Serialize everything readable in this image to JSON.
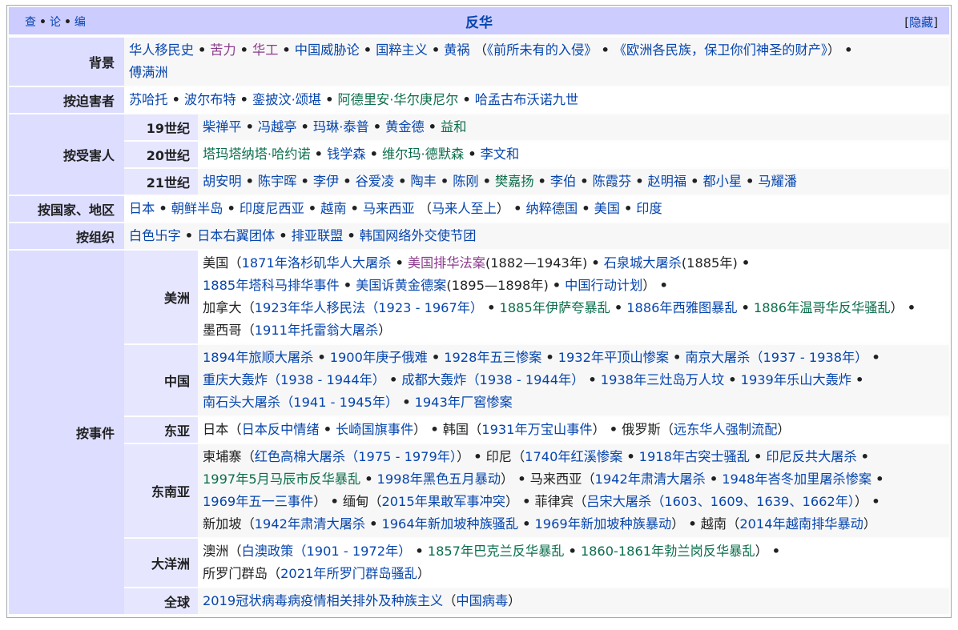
{
  "navbox": {
    "title": "反华",
    "vte": [
      "查",
      "论",
      "编"
    ],
    "hide_label": "隐藏",
    "hide_brackets": [
      "[",
      "]"
    ]
  },
  "rows": {
    "background": {
      "label": "背景",
      "items": [
        "华人移民史",
        "苦力",
        "华工",
        "中国威胁论",
        "国粹主义",
        "黄祸"
      ],
      "paren_items": [
        "《前所未有的入侵》",
        "《欧洲各民族，保卫你们神圣的财产》"
      ],
      "tail": [
        "傅满洲"
      ]
    },
    "persecutors": {
      "label": "按迫害者",
      "items": [
        "苏哈托",
        "波尔布特",
        "銮披汶·颂堪",
        "阿德里安·华尔庚尼尔",
        "哈孟古布沃诺九世"
      ]
    },
    "victims": {
      "label": "按受害人",
      "c19_label": "19世纪",
      "c19": [
        "柴禅平",
        "冯越亭",
        "玛琳·泰普",
        "黄金德",
        "益和"
      ],
      "c20_label": "20世纪",
      "c20": [
        "塔玛塔纳塔·哈约诺",
        "钱学森",
        "维尔玛·德默森",
        "李文和"
      ],
      "c21_label": "21世纪",
      "c21": [
        "胡安明",
        "陈宇晖",
        "李伊",
        "谷爱凌",
        "陶丰",
        "陈刚",
        "樊嘉扬",
        "李伯",
        "陈霞芬",
        "赵明福",
        "都小星",
        "马耀潘"
      ]
    },
    "countries": {
      "label": "按国家、地区",
      "items_a": [
        "日本",
        "朝鲜半岛",
        "印度尼西亚",
        "越南",
        "马来西亚"
      ],
      "paren": "马来人至上",
      "items_b": [
        "纳粹德国",
        "美国",
        "印度"
      ]
    },
    "orgs": {
      "label": "按组织",
      "items": [
        "白色卐字",
        "日本右翼团体",
        "排亚联盟",
        "韩国网络外交使节团"
      ]
    },
    "events": {
      "label": "按事件",
      "americas": {
        "label": "美洲",
        "us": "美国",
        "us_items": [
          "1871年洛杉矶华人大屠杀",
          "美国排华法案",
          "(1882—1943年)",
          "石泉城大屠杀",
          "(1885年)",
          "1885年塔科马排华事件",
          "美国诉黄金德案",
          "(1895—1898年)",
          "中国行动计划"
        ],
        "canada": "加拿大",
        "canada_items": [
          "1923年华人移民法（1923 - 1967年）",
          "1885年伊萨夸暴乱",
          "1886年西雅图暴乱",
          "1886年温哥华反华骚乱"
        ],
        "mexico": "墨西哥",
        "mexico_items": [
          "1911年托雷翁大屠杀"
        ]
      },
      "china": {
        "label": "中国",
        "items": [
          "1894年旅顺大屠杀",
          "1900年庚子俄难",
          "1928年五三惨案",
          "1932年平顶山惨案",
          "南京大屠杀（1937 - 1938年）",
          "重庆大轰炸（1938 - 1944年）",
          "成都大轰炸（1938 - 1944年）",
          "1938年三灶岛万人坟",
          "1939年乐山大轰炸",
          "南石头大屠杀（1941 - 1945年）",
          "1943年厂窖惨案"
        ]
      },
      "east_asia": {
        "label": "东亚",
        "japan": "日本",
        "japan_items": [
          "日本反中情绪",
          "长崎国旗事件"
        ],
        "korea": "韩国",
        "korea_items": [
          "1931年万宝山事件"
        ],
        "russia": "俄罗斯",
        "russia_items": [
          "远东华人强制流配"
        ]
      },
      "southeast_asia": {
        "label": "东南亚",
        "cambodia": "柬埔寨",
        "cambodia_items": [
          "红色高棉大屠杀（1975 - 1979年）"
        ],
        "indonesia": "印尼",
        "indonesia_items": [
          "1740年红溪惨案",
          "1918年古突士骚乱",
          "印尼反共大屠杀",
          "1997年5月马辰市反华暴乱",
          "1998年黑色五月暴动"
        ],
        "malaysia": "马来西亚",
        "malaysia_items": [
          "1942年肃清大屠杀",
          "1948年峇冬加里屠杀惨案",
          "1969年五一三事件"
        ],
        "myanmar": "缅甸",
        "myanmar_items": [
          "2015年果敢军事冲突"
        ],
        "philippines": "菲律宾",
        "philippines_items": [
          "吕宋大屠杀（1603、1609、1639、1662年）"
        ],
        "singapore": "新加坡",
        "singapore_items": [
          "1942年肃清大屠杀",
          "1964年新加坡种族骚乱",
          "1969年新加坡种族暴动"
        ],
        "vietnam": "越南",
        "vietnam_items": [
          "2014年越南排华暴动"
        ]
      },
      "oceania": {
        "label": "大洋洲",
        "australia": "澳洲",
        "australia_items": [
          "白澳政策（1901 - 1972年）",
          "1857年巴克兰反华暴乱",
          "1860-1861年勃兰岗反华暴乱"
        ],
        "solomon": "所罗门群岛",
        "solomon_items": [
          "2021年所罗门群岛骚乱"
        ]
      },
      "global": {
        "label": "全球",
        "item": "2019冠状病毒病疫情相关排外及种族主义",
        "paren": "中国病毒"
      }
    }
  },
  "colors": {
    "header_bg": "#ccccff",
    "group_bg": "#ddddff",
    "link": "#0645ad",
    "visited": "#8b3a8b",
    "green_link": "#0b6e4a"
  }
}
